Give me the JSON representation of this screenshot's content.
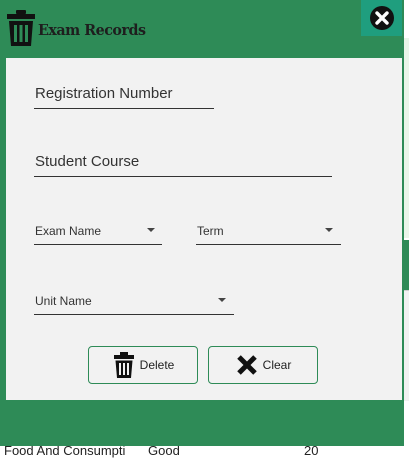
{
  "dialog": {
    "title": "Exam Records",
    "title_icon": "trash-icon",
    "close_icon": "close-circle-icon"
  },
  "form": {
    "registration_number": {
      "placeholder": "Registration Number",
      "value": ""
    },
    "student_course": {
      "placeholder": "Student Course",
      "value": ""
    },
    "exam_name": {
      "placeholder": "Exam Name",
      "selected": ""
    },
    "term": {
      "placeholder": "Term",
      "selected": ""
    },
    "unit_name": {
      "placeholder": "Unit Name",
      "selected": ""
    }
  },
  "buttons": {
    "delete_label": "Delete",
    "delete_icon": "trash-icon",
    "clear_label": "Clear",
    "clear_icon": "x-icon"
  },
  "background_table": {
    "visible_row": [
      "Food And Consumpti",
      "Good",
      "20"
    ]
  },
  "colors": {
    "frame_green": "#2e8b57",
    "close_teal": "#1f9e7e",
    "panel_bg": "#f2f2f2"
  }
}
